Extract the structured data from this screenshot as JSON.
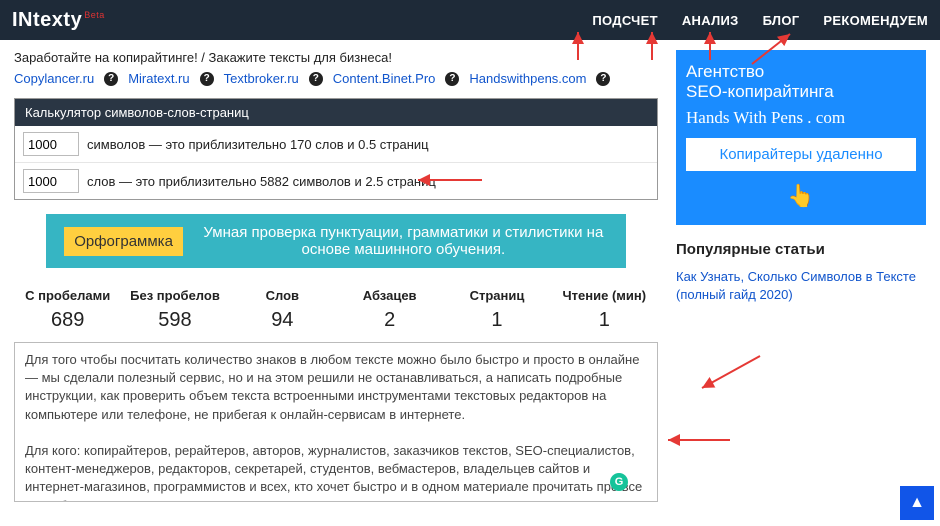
{
  "header": {
    "logo_main": "INtexty",
    "logo_beta": "Beta",
    "nav": [
      "ПОДСЧЕТ",
      "АНАЛИЗ",
      "БЛОГ",
      "РЕКОМЕНДУЕМ"
    ]
  },
  "promo_line": "Заработайте на копирайтинге! / Закажите тексты для бизнеса!",
  "affiliates": [
    "Copylancer.ru",
    "Miratext.ru",
    "Textbroker.ru",
    "Content.Binet.Pro",
    "Handswithpens.com"
  ],
  "calc": {
    "title": "Калькулятор символов-слов-страниц",
    "row1_value": "1000",
    "row1_text": "символов — это приблизительно 170 слов и 0.5 страниц",
    "row2_value": "1000",
    "row2_text": "слов — это приблизительно 5882 символов и 2.5 страниц"
  },
  "orfo": {
    "button": "Орфограммка",
    "text": "Умная проверка пунктуации, грамматики и стилистики на основе машинного обучения."
  },
  "stats": {
    "labels": [
      "С пробелами",
      "Без пробелов",
      "Слов",
      "Абзацев",
      "Страниц",
      "Чтение (мин)"
    ],
    "values": [
      "689",
      "598",
      "94",
      "2",
      "1",
      "1"
    ]
  },
  "textarea_value": "Для того чтобы посчитать количество знаков в любом тексте можно было быстро и просто в онлайне — мы сделали полезный сервис, но и на этом решили не останавливаться, а написать подробные инструкции, как проверить объем текста встроенными инструментами текстовых редакторов на компьютере или телефоне, не прибегая к онлайн-сервисам в интернете.\n\nДля кого: копирайтеров, рерайтеров, авторов, журналистов, заказчиков текстов, SEO-специалистов, контент-менеджеров, редакторов, секретарей, студентов, вебмастеров, владельцев сайтов и интернет-магазинов, программистов и всех, кто хочет быстро и в одном материале прочитать про все способы и сервисы проверки текста на количество символов и слов.",
  "ad": {
    "l1": "Агентство",
    "l2": "SEO-копирайтинга",
    "l3": "Hands With Pens . com",
    "cta": "Копирайтеры удаленно"
  },
  "popular": {
    "title": "Популярные статьи",
    "link": "Как Узнать, Сколько Символов в Тексте (полный гайд 2020)"
  },
  "grammarly_badge": "G"
}
